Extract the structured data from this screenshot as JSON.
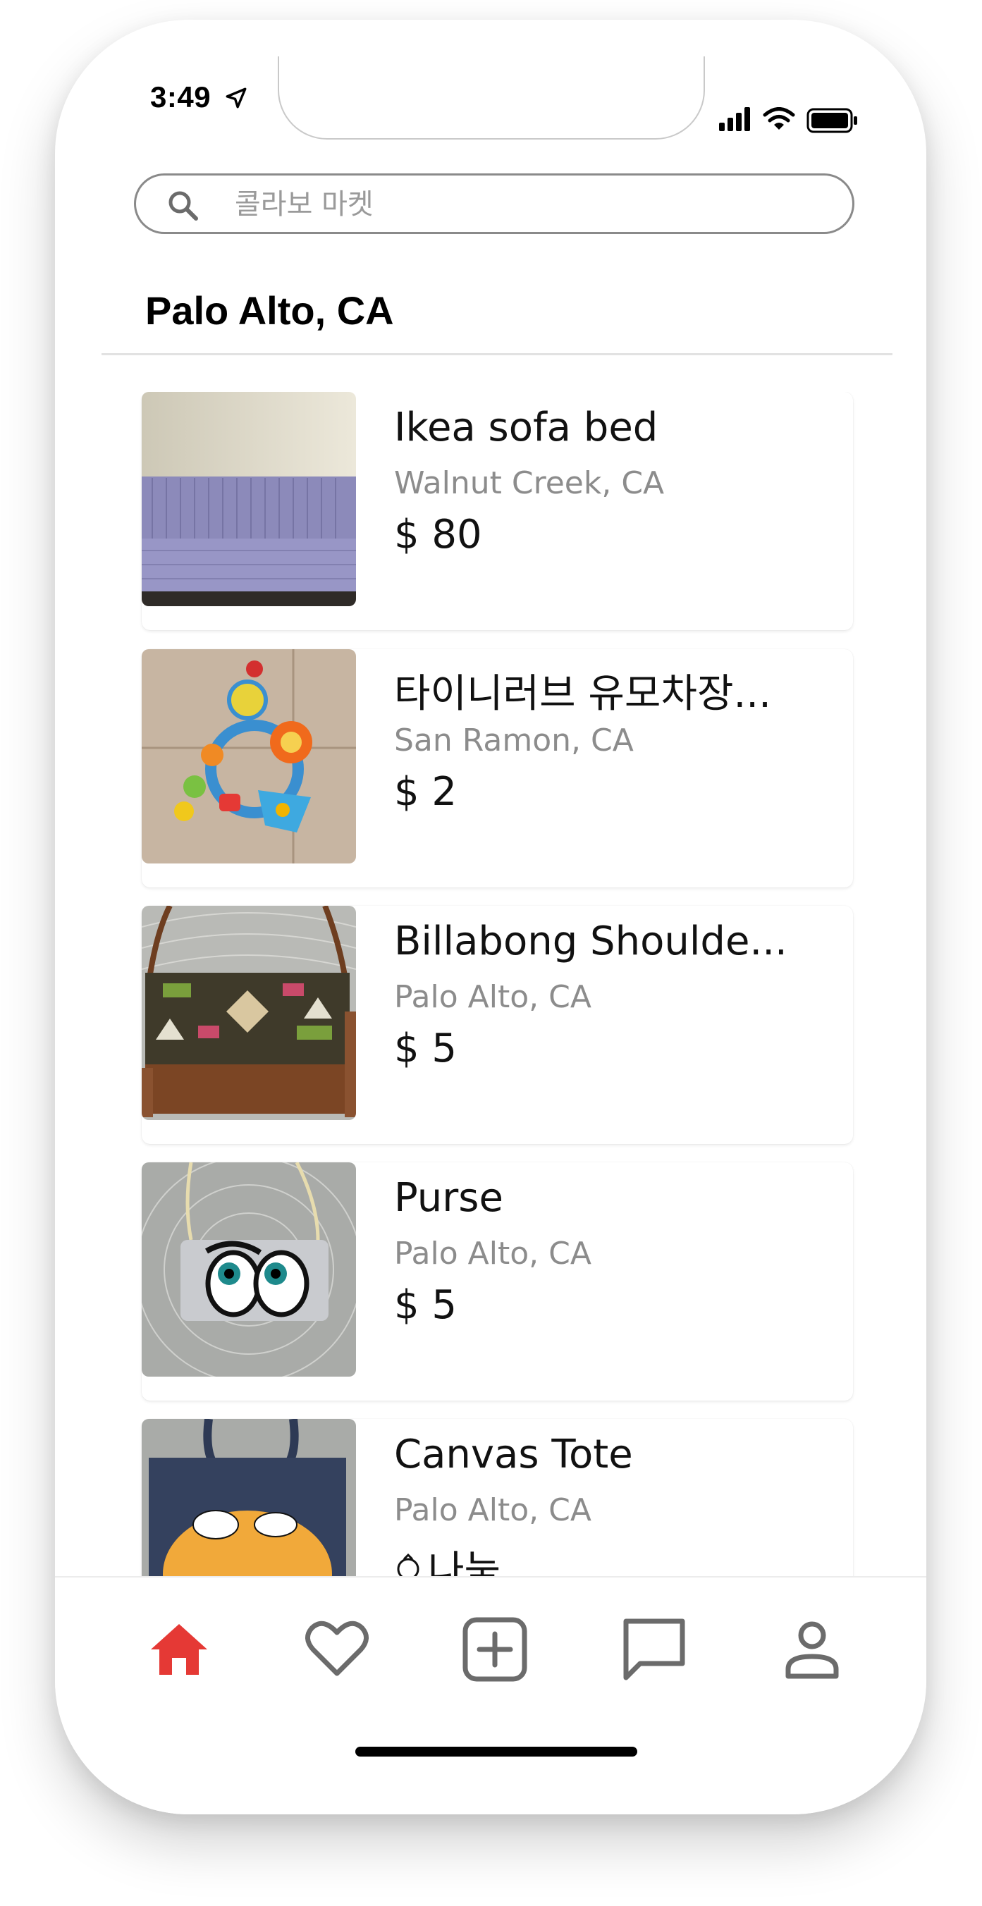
{
  "status_bar": {
    "time": "3:49"
  },
  "search": {
    "placeholder": "콜라보 마켓",
    "value": ""
  },
  "location": {
    "title": "Palo Alto, CA"
  },
  "listings": [
    {
      "title": "Ikea sofa bed",
      "location": "Walnut Creek, CA",
      "price": "$ 80"
    },
    {
      "title": "타이니러브 유모차장...",
      "location": "San Ramon, CA",
      "price": "$ 2"
    },
    {
      "title": "Billabong Shoulde...",
      "location": "Palo Alto, CA",
      "price": "$ 5"
    },
    {
      "title": "Purse",
      "location": "Palo Alto, CA",
      "price": "$ 5"
    },
    {
      "title": "Canvas Tote",
      "location": "Palo Alto, CA",
      "price": "나눔"
    }
  ],
  "nav": {
    "active": "home",
    "items": [
      "home",
      "favorites",
      "add",
      "chat",
      "profile"
    ],
    "active_color": "#e53935",
    "inactive_color": "#6b6b6b"
  }
}
